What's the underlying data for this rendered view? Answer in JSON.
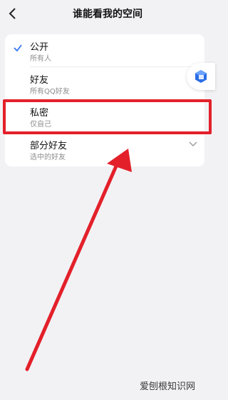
{
  "header": {
    "title": "谁能看我的空间"
  },
  "options": [
    {
      "label": "公开",
      "sub": "所有人",
      "selected": true
    },
    {
      "label": "好友",
      "sub": "所有QQ好友",
      "selected": false
    },
    {
      "label": "私密",
      "sub": "仅自己",
      "selected": false
    },
    {
      "label": "部分好友",
      "sub": "选中的好友",
      "selected": false
    }
  ],
  "colors": {
    "check": "#3478f6",
    "highlight": "#e3202a"
  },
  "watermark": {
    "text": "爱刨根知识网"
  }
}
